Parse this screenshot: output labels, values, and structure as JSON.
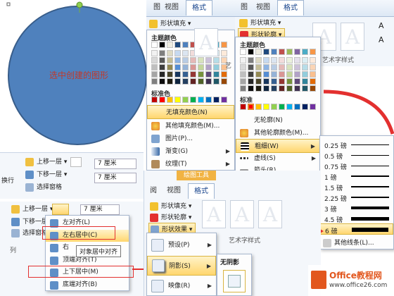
{
  "shape": {
    "label": "选中创建的图形",
    "fill": "#4f81bd",
    "stroke": "#385d8a",
    "text_color": "#c0392b"
  },
  "ribbon_top": {
    "tabs_left": [
      "图",
      "视图",
      "格式"
    ],
    "tabs_right": [
      "图",
      "视图",
      "格式"
    ]
  },
  "fill_menu": {
    "button": "形状填充",
    "theme_colors": "主题颜色",
    "standard_colors": "标准色",
    "no_fill": "无填充颜色(N)",
    "more_fill": "其他填充颜色(M)...",
    "picture": "图片(P)...",
    "gradient": "渐变(G)",
    "texture": "纹理(T)"
  },
  "outline_menu": {
    "fill_button": "形状填充",
    "button": "形状轮廓",
    "art_group": "艺术字样式",
    "theme_colors": "主题颜色",
    "standard": "标准",
    "no_outline": "无轮廓(N)",
    "more_outline": "其他轮廓颜色(M)...",
    "weight": "粗细(W)",
    "dashes": "虚线(S)",
    "arrows": "箭头(R)"
  },
  "weights": {
    "items": [
      "0.25 磅",
      "0.5 磅",
      "0.75 磅",
      "1 磅",
      "1.5 磅",
      "2.25 磅",
      "3 磅",
      "4.5 磅",
      "6 磅"
    ],
    "more": "其他线条(L)..."
  },
  "art_group_mid": "艺",
  "arrange": {
    "bring_forward": "上移一层",
    "send_backward": "下移一层",
    "selection_pane": "选择窗格",
    "wrap": "换行",
    "height": "7 厘米",
    "width": "7 厘米"
  },
  "align": {
    "bring_forward": "上移一层",
    "send_backward": "下移一层",
    "selection_pane": "选择窗格",
    "size": "7 厘米",
    "group_label": "列",
    "items": [
      "左对齐(L)",
      "左右居中(C)",
      "右",
      "顶端对齐(T)",
      "上下居中(M)",
      "底端对齐(B)"
    ],
    "tooltip": "对象居中对齐"
  },
  "effects": {
    "drawing_tools": "绘图工具",
    "tabs": [
      "阅",
      "视图",
      "格式"
    ],
    "fill_button": "形状填充",
    "outline_button": "形状轮廓",
    "effects_button": "形状效果",
    "art_group": "艺术字样式",
    "presets": "预设(P)",
    "shadow": "阴影(S)",
    "reflection": "映像(R)",
    "no_shadow": "无阴影"
  },
  "watermark": {
    "brand": "Office教程网",
    "url": "www.office26.com"
  },
  "colors": {
    "highlight": "#ffd66e",
    "annotation": "#e3302f",
    "brand_orange": "#e2571e"
  }
}
